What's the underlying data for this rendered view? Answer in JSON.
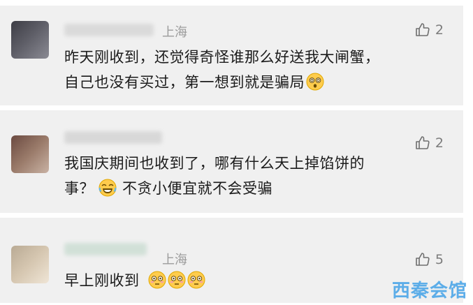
{
  "comments": [
    {
      "location": "上海",
      "likes": "2",
      "line1": "昨天刚收到，还觉得奇怪谁那么好送我大闸蟹，",
      "line2": "自己也没有买过，第一想到就是骗局"
    },
    {
      "location": "",
      "likes": "2",
      "line1": "我国庆期间也收到了，哪有什么天上掉馅饼的",
      "line2a": "事？",
      "line2b": "不贪小便宜就不会受骗"
    },
    {
      "location": "上海",
      "likes": "5",
      "line1": "早上刚收到"
    }
  ],
  "watermark": "西秦会馆",
  "icons": {
    "like": "thumbs-up-icon",
    "dizzy": "dizzy-face-emoji",
    "laugh_cry": "rolling-laughing-emoji",
    "flushed": "flushed-face-emoji"
  }
}
